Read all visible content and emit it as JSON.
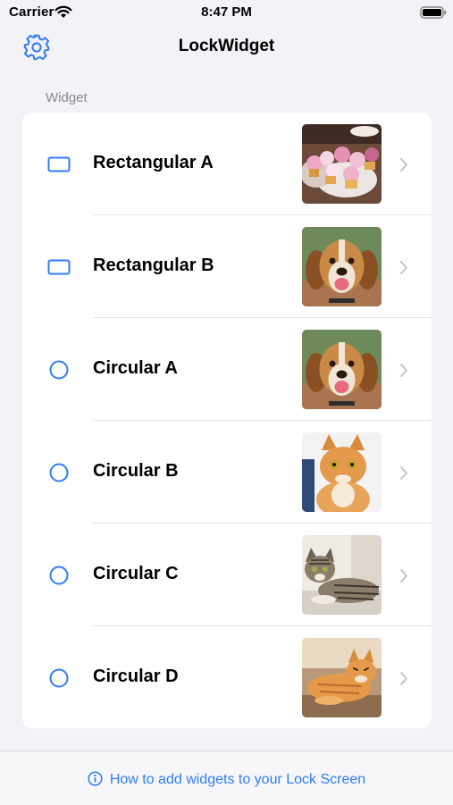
{
  "status_bar": {
    "carrier": "Carrier",
    "time": "8:47 PM",
    "icons": [
      "wifi-icon",
      "battery-icon"
    ]
  },
  "nav": {
    "title": "LockWidget",
    "left_icon": "gear-icon"
  },
  "section": {
    "header": "Widget"
  },
  "widgets": [
    {
      "label": "Rectangular A",
      "shape": "rectangle-icon",
      "image": "cupcakes"
    },
    {
      "label": "Rectangular B",
      "shape": "rectangle-icon",
      "image": "beagle-dog"
    },
    {
      "label": "Circular A",
      "shape": "circle-icon",
      "image": "beagle-dog"
    },
    {
      "label": "Circular B",
      "shape": "circle-icon",
      "image": "orange-kitten"
    },
    {
      "label": "Circular C",
      "shape": "circle-icon",
      "image": "tabby-cat"
    },
    {
      "label": "Circular D",
      "shape": "circle-icon",
      "image": "orange-cat-lying"
    }
  ],
  "footer": {
    "help_text": "How to add widgets to your Lock Screen",
    "icon": "info-icon"
  },
  "colors": {
    "accent": "#2f7cf6",
    "background": "#f2f2f7",
    "card": "#ffffff",
    "secondary_text": "#8a8a8e"
  }
}
